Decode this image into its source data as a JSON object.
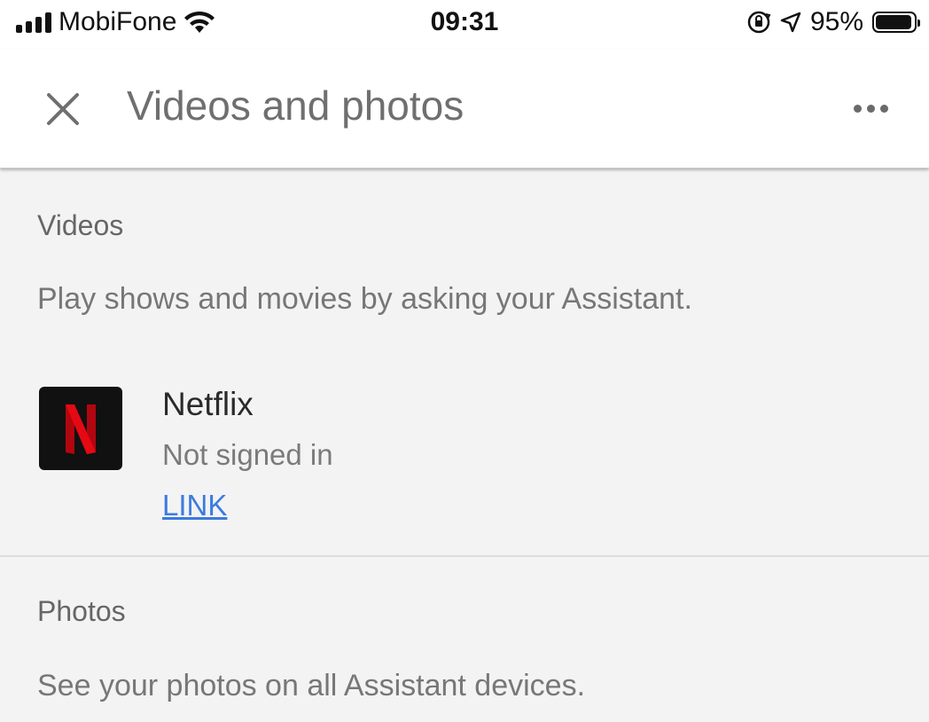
{
  "status_bar": {
    "carrier": "MobiFone",
    "time": "09:31",
    "battery": "95%",
    "battery_level": 0.95,
    "icons": [
      "signal-icon",
      "wifi-icon",
      "orientation-lock-icon",
      "location-icon",
      "battery-icon"
    ]
  },
  "header": {
    "title": "Videos and photos",
    "icons": [
      "close-icon",
      "more-icon"
    ]
  },
  "videos": {
    "title": "Videos",
    "description": "Play shows and movies by asking your Assistant.",
    "providers": [
      {
        "name": "Netflix",
        "status": "Not signed in",
        "action": "LINK",
        "logo_letter": "N",
        "logo_color": "#e50914"
      }
    ]
  },
  "photos": {
    "title": "Photos",
    "description": "See your photos on all Assistant devices."
  },
  "colors": {
    "link": "#3b7be0",
    "background": "#f3f3f3",
    "app_bar": "#ffffff"
  }
}
